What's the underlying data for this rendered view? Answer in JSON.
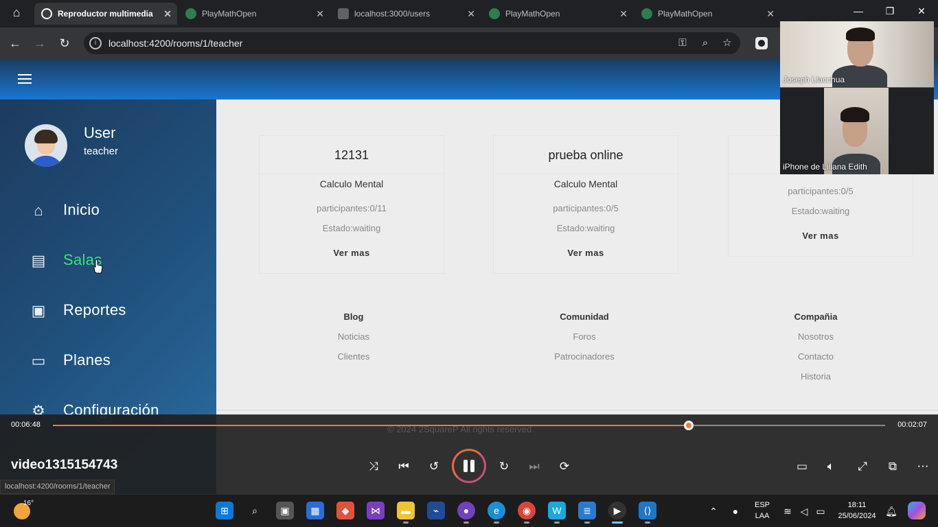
{
  "browser": {
    "tabs": [
      {
        "title": "Reproductor multimedia",
        "active": true
      },
      {
        "title": "PlayMathOpen",
        "active": false
      },
      {
        "title": "localhost:3000/users",
        "active": false
      },
      {
        "title": "PlayMathOpen",
        "active": false
      },
      {
        "title": "PlayMathOpen",
        "active": false
      }
    ],
    "url": "localhost:4200/rooms/1/teacher"
  },
  "user": {
    "name": "User",
    "role": "teacher"
  },
  "sidebar": {
    "items": [
      {
        "label": "Inicio",
        "icon": "home-icon"
      },
      {
        "label": "Salas",
        "icon": "clipboard-icon",
        "active": true
      },
      {
        "label": "Reportes",
        "icon": "report-icon"
      },
      {
        "label": "Planes",
        "icon": "money-icon"
      },
      {
        "label": "Configuración",
        "icon": "gear-icon"
      }
    ]
  },
  "rooms": [
    {
      "title": "12131",
      "type": "Calculo Mental",
      "participants": "participantes:0/11",
      "status": "Estado:waiting",
      "link": "Ver mas"
    },
    {
      "title": "prueba online",
      "type": "Calculo Mental",
      "participants": "participantes:0/5",
      "status": "Estado:waiting",
      "link": "Ver mas"
    },
    {
      "participants": "participantes:0/5",
      "status": "Estado:waiting",
      "link": "Ver mas"
    }
  ],
  "footer": {
    "columns": [
      {
        "heading": "Blog",
        "links": [
          "Noticias",
          "Clientes"
        ]
      },
      {
        "heading": "Comunidad",
        "links": [
          "Foros",
          "Patrocinadores"
        ]
      },
      {
        "heading": "Compañia",
        "links": [
          "Nosotros",
          "Contacto",
          "Historia"
        ]
      }
    ],
    "copyright": "© 2024 2SquareP All rights reserved"
  },
  "call": {
    "participants": [
      {
        "name": "Joseph Llacchua"
      },
      {
        "name": "iPhone de Liliana Edith"
      }
    ]
  },
  "player": {
    "elapsed": "00:06:48",
    "remaining": "00:02:07",
    "progress": 0.764,
    "title": "video1315154743"
  },
  "status_bar_url": "localhost:4200/rooms/1/teacher",
  "taskbar": {
    "weather_temp": "16°",
    "lang": "ESP",
    "layout": "LAA",
    "time": "18:11",
    "date": "25/06/2024"
  },
  "colors": {
    "accent_active": "#39e37a",
    "header_blue": "#1976d2",
    "player_accent": "#f07a3a"
  }
}
